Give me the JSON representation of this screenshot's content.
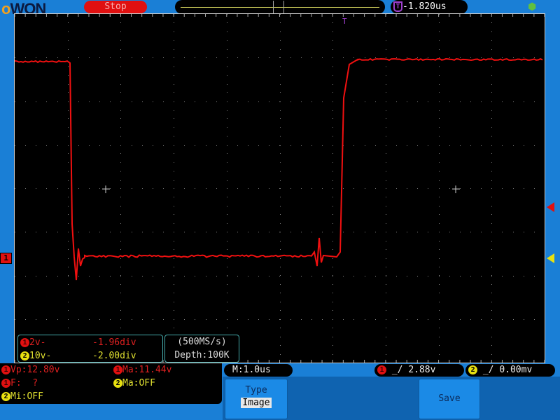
{
  "header": {
    "logo": "OWON",
    "run_state": "Stop",
    "trigger_time": "-1.820us",
    "trigger_marker": "T"
  },
  "channels": [
    {
      "id": "1",
      "scale": "2v-",
      "offset": "-1.96div",
      "color": "#e01010"
    },
    {
      "id": "2",
      "scale": "10v-",
      "offset": "-2.00div",
      "color": "#e8e010"
    }
  ],
  "acquisition": {
    "sample_rate": "(500MS/s)",
    "depth": "Depth:100K"
  },
  "measurements": {
    "vp": "Vp:12.80v",
    "ma1": "Ma:11.44v",
    "f": "F:  ?",
    "ma2": "Ma:OFF",
    "mi2": "Mi:OFF"
  },
  "timebase": "M:1.0us",
  "triggers": [
    {
      "ch": "1",
      "level": "2.88v"
    },
    {
      "ch": "2",
      "level": "0.00mv"
    }
  ],
  "menu": {
    "type_label": "Type",
    "type_value": "Image",
    "save_label": "Save"
  },
  "ground_marker": "1"
}
